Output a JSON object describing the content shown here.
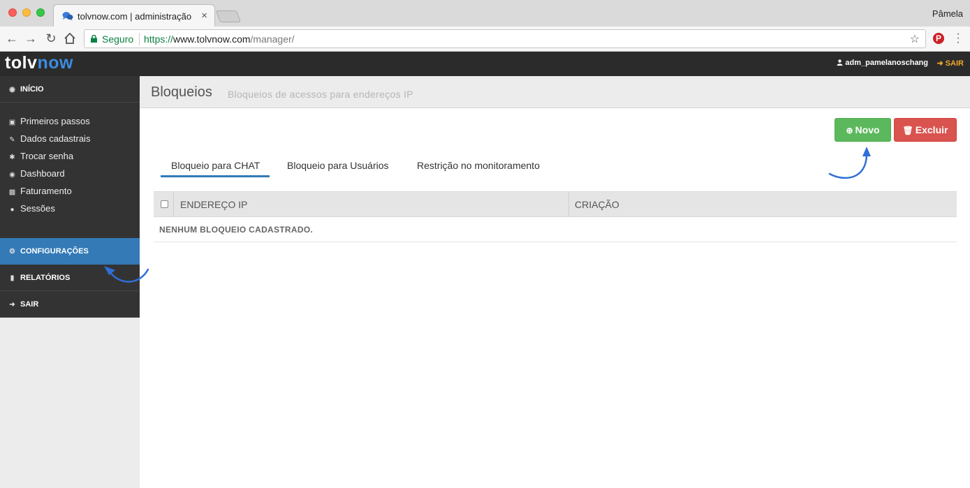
{
  "browser": {
    "tab_title": "tolvnow.com | administração",
    "profile_name": "Pâmela",
    "secure_label": "Seguro",
    "url_scheme": "https://",
    "url_host": "www.tolvnow.com",
    "url_path": "/manager/"
  },
  "header": {
    "logo_part1": "tolv",
    "logo_part2": "now",
    "username": "adm_pamelanoschang",
    "logout_label": "SAIR"
  },
  "sidebar": {
    "inicio": "INÍCIO",
    "items": [
      {
        "icon": "camera-icon",
        "label": "Primeiros passos"
      },
      {
        "icon": "edit-icon",
        "label": "Dados cadastrais"
      },
      {
        "icon": "asterisk-icon",
        "label": "Trocar senha"
      },
      {
        "icon": "dashboard-icon",
        "label": "Dashboard"
      },
      {
        "icon": "money-icon",
        "label": "Faturamento"
      },
      {
        "icon": "user-icon",
        "label": "Sessões"
      }
    ],
    "configuracoes": "CONFIGURAÇÕES",
    "relatorios": "RELATÓRIOS",
    "sair": "SAIR"
  },
  "page": {
    "title": "Bloqueios",
    "subtitle": "Bloqueios de acessos para endereços IP"
  },
  "buttons": {
    "new_label": "Novo",
    "delete_label": "Excluir"
  },
  "tabs": [
    {
      "label": "Bloqueio para CHAT",
      "active": true
    },
    {
      "label": "Bloqueio para Usuários",
      "active": false
    },
    {
      "label": "Restrição no monitoramento",
      "active": false
    }
  ],
  "table": {
    "columns": [
      "ENDEREÇO IP",
      "CRIAÇÃO"
    ],
    "empty_message": "NENHUM BLOQUEIO CADASTRADO."
  },
  "colors": {
    "accent_blue": "#337ab7",
    "success_green": "#5cb85c",
    "danger_red": "#d9534f",
    "header_dark": "#2b2b2b",
    "logout_orange": "#f0a82b"
  }
}
